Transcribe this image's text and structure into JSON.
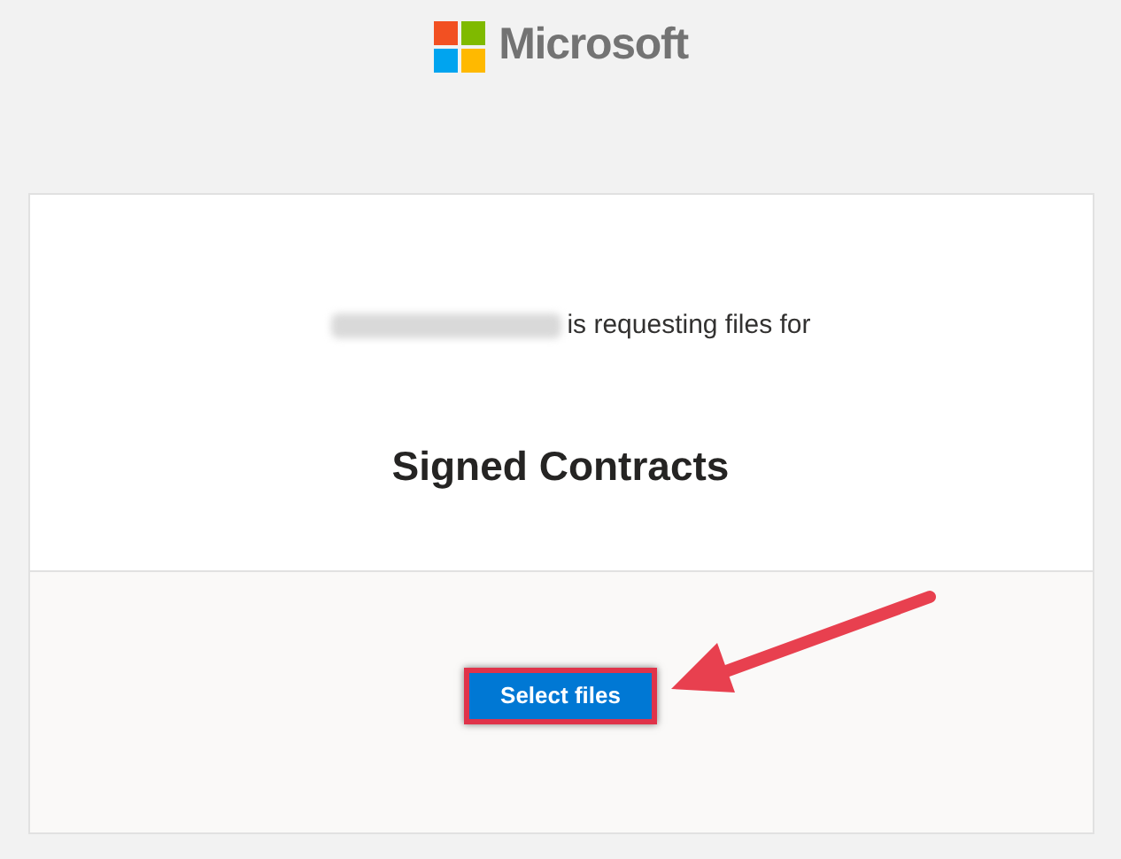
{
  "header": {
    "brand": "Microsoft"
  },
  "request": {
    "text": "is requesting files for",
    "folder": "Signed Contracts"
  },
  "button": {
    "label": "Select files",
    "highlighted": true
  }
}
